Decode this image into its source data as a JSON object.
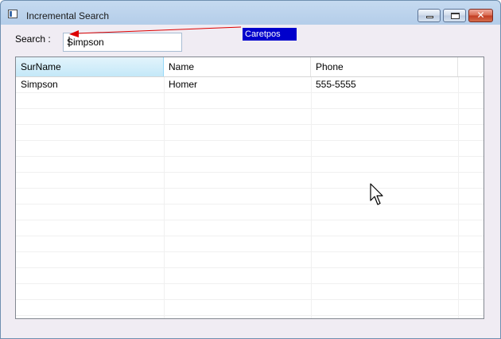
{
  "window": {
    "title": "Incremental Search",
    "icon": "app-window-icon",
    "controls": {
      "minimize": "minimize-icon",
      "maximize": "maximize-icon",
      "close": "close-icon",
      "close_glyph": "✕"
    }
  },
  "search": {
    "label": "Search :",
    "value": "Simpson"
  },
  "annotation": {
    "text": "Caretpos",
    "color": "#0000cc",
    "arrow_color": "#dd0000"
  },
  "grid": {
    "columns": [
      "SurName",
      "Name",
      "Phone"
    ],
    "rows": [
      [
        "Simpson",
        "Homer",
        "555-5555"
      ]
    ],
    "empty_row_count": 15
  }
}
